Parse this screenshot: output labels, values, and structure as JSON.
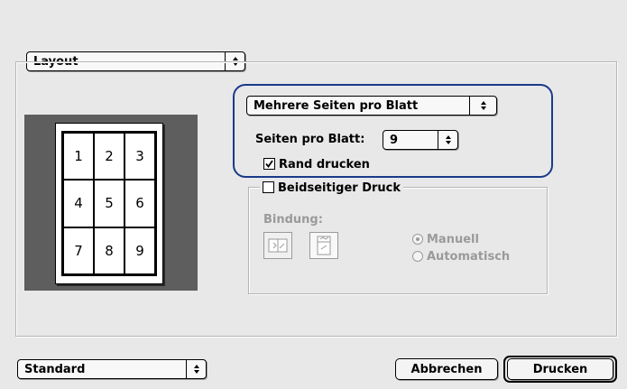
{
  "panel_menu": {
    "value": "Layout"
  },
  "layout": {
    "pages_mode_menu": {
      "value": "Mehrere Seiten pro Blatt"
    },
    "pages_per_sheet": {
      "label": "Seiten pro Blatt:",
      "value": "9"
    },
    "print_border": {
      "label": "Rand drucken",
      "checked": true
    },
    "preview": {
      "cells": [
        "1",
        "2",
        "3",
        "4",
        "5",
        "6",
        "7",
        "8",
        "9"
      ]
    },
    "highlight_color": "#1a3a8a"
  },
  "duplex": {
    "label": "Beidseitiger Druck",
    "checked": false,
    "binding_label": "Bindung:",
    "options": [
      {
        "label": "Manuell",
        "selected": true
      },
      {
        "label": "Automatisch",
        "selected": false
      }
    ],
    "binding_icons": [
      "long-edge-binding-icon",
      "short-edge-binding-icon"
    ]
  },
  "footer": {
    "preset_menu": {
      "value": "Standard"
    },
    "cancel_label": "Abbrechen",
    "print_label": "Drucken"
  }
}
